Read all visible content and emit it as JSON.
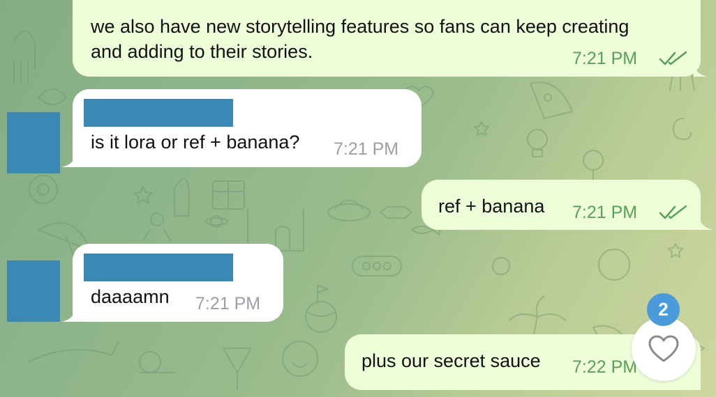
{
  "colors": {
    "outgoing_bubble": "#eefed9",
    "incoming_bubble": "#ffffff",
    "outgoing_time": "#5aa05c",
    "incoming_time": "#9aa0a6",
    "redacted": "#3b88b5",
    "badge": "#4a9bdc"
  },
  "messages": [
    {
      "direction": "outgoing",
      "lines": [
        "we also have new storytelling features so fans can keep creating",
        "and adding to their stories."
      ],
      "time": "7:21 PM",
      "status": "read"
    },
    {
      "direction": "incoming",
      "text": "is it lora or ref + banana?",
      "time": "7:21 PM"
    },
    {
      "direction": "outgoing",
      "text": "ref + banana",
      "time": "7:21 PM",
      "status": "read"
    },
    {
      "direction": "incoming",
      "text": "daaaamn",
      "time": "7:21 PM"
    },
    {
      "direction": "outgoing",
      "text": "plus our secret sauce",
      "time": "7:22 PM"
    }
  ],
  "reaction_button": {
    "icon": "heart-outline-icon",
    "badge_count": "2"
  }
}
